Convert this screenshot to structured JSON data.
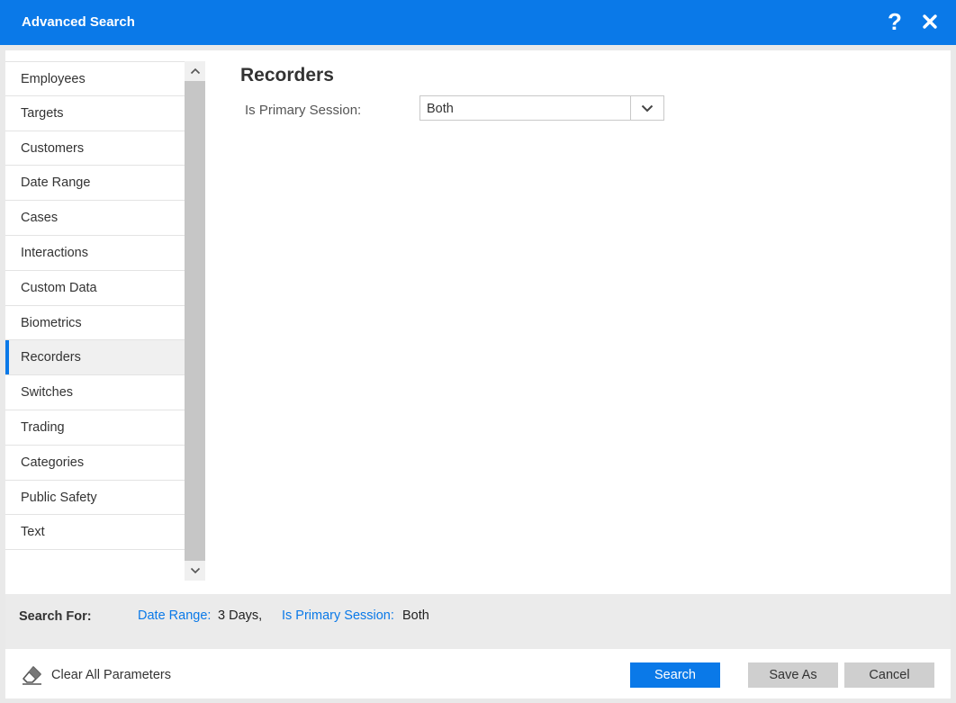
{
  "dialog": {
    "title": "Advanced Search",
    "help_icon": "question-mark-icon",
    "close_icon": "close-icon",
    "accent_color": "#0a79e8"
  },
  "sidebar": {
    "active": "Recorders",
    "items": [
      {
        "label": "Employees"
      },
      {
        "label": "Targets"
      },
      {
        "label": "Customers"
      },
      {
        "label": "Date Range"
      },
      {
        "label": "Cases"
      },
      {
        "label": "Interactions"
      },
      {
        "label": "Custom Data"
      },
      {
        "label": "Biometrics"
      },
      {
        "label": "Recorders"
      },
      {
        "label": "Switches"
      },
      {
        "label": "Trading"
      },
      {
        "label": "Categories"
      },
      {
        "label": "Public Safety"
      },
      {
        "label": "Text"
      }
    ]
  },
  "main": {
    "section_title": "Recorders",
    "fields": [
      {
        "label": "Is Primary Session:",
        "value": "Both"
      }
    ]
  },
  "summary": {
    "label": "Search For:",
    "criteria": [
      {
        "key": "Date Range:",
        "value": "3 Days,"
      },
      {
        "key": "Is Primary Session:",
        "value": "Both"
      }
    ]
  },
  "footer": {
    "clear_label": "Clear All Parameters",
    "clear_icon": "eraser-icon",
    "search_label": "Search",
    "save_as_label": "Save As",
    "cancel_label": "Cancel"
  }
}
